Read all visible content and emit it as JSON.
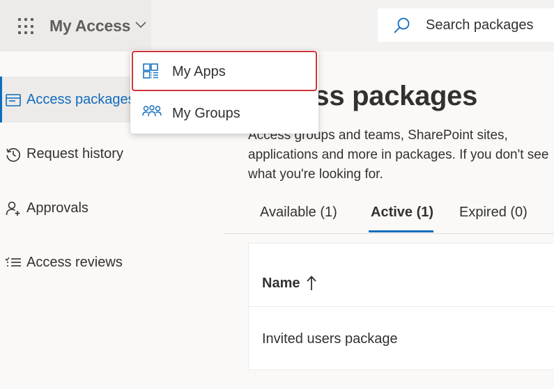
{
  "header": {
    "app_title": "My Access",
    "waffle_icon": "app-launcher-icon",
    "chevron_icon": "chevron-down-icon",
    "search": {
      "placeholder": "Search packages",
      "icon": "search-icon"
    }
  },
  "app_menu": {
    "items": [
      {
        "label": "My Apps",
        "icon": "apps-grid-icon",
        "highlighted": true
      },
      {
        "label": "My Groups",
        "icon": "people-group-icon",
        "highlighted": false
      }
    ]
  },
  "sidebar": {
    "items": [
      {
        "label": "Access packages",
        "icon": "package-icon",
        "active": true
      },
      {
        "label": "Request history",
        "icon": "history-icon",
        "active": false
      },
      {
        "label": "Approvals",
        "icon": "person-check-icon",
        "active": false
      },
      {
        "label": "Access reviews",
        "icon": "checklist-icon",
        "active": false
      }
    ]
  },
  "main": {
    "title": "Access packages",
    "description": "Access groups and teams, SharePoint sites, applications and more in packages. If you don't see what you're looking for.",
    "tabs": [
      {
        "label": "Available (1)",
        "active": false
      },
      {
        "label": "Active (1)",
        "active": true
      },
      {
        "label": "Expired (0)",
        "active": false
      }
    ],
    "table": {
      "columns": [
        {
          "label": "Name",
          "sort": "ascending",
          "sort_icon": "arrow-up-icon"
        }
      ],
      "rows": [
        {
          "name": "Invited users package"
        }
      ]
    }
  },
  "colors": {
    "accent": "#0f6cbd",
    "highlight_border": "#d13438",
    "topbar_bg": "#f3f2f1",
    "page_bg": "#faf9f8"
  }
}
